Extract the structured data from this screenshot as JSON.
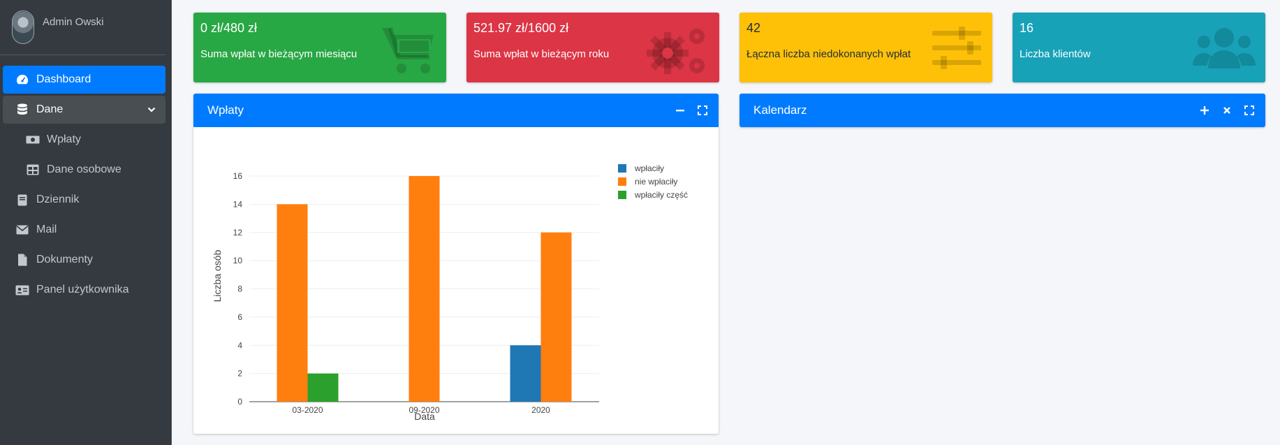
{
  "user": {
    "name": "Admin Owski"
  },
  "sidebar": {
    "items": [
      {
        "label": "Dashboard",
        "icon": "tachometer-icon"
      },
      {
        "label": "Dane",
        "icon": "database-icon"
      },
      {
        "label": "Wpłaty",
        "icon": "money-bill-icon"
      },
      {
        "label": "Dane osobowe",
        "icon": "table-icon"
      },
      {
        "label": "Dziennik",
        "icon": "book-icon"
      },
      {
        "label": "Mail",
        "icon": "envelope-icon"
      },
      {
        "label": "Dokumenty",
        "icon": "file-icon"
      },
      {
        "label": "Panel użytkownika",
        "icon": "id-card-icon"
      }
    ]
  },
  "info_boxes": [
    {
      "value": "0 zł/480 zł",
      "label": "Suma wpłat w bieżącym miesiącu",
      "color": "#28a745",
      "icon": "shopping-cart-icon"
    },
    {
      "value": "521.97 zł/1600 zł",
      "label": "Suma wpłat w bieżącym roku",
      "color": "#dc3545",
      "icon": "cogs-icon"
    },
    {
      "value": "42",
      "label": "Łączna liczba niedokonanych wpłat",
      "color": "#ffc107",
      "icon": "sliders-icon"
    },
    {
      "value": "16",
      "label": "Liczba klientów",
      "color": "#17a2b8",
      "icon": "users-icon"
    }
  ],
  "cards": {
    "payments": {
      "title": "Wpłaty"
    },
    "calendar": {
      "title": "Kalendarz"
    }
  },
  "chart_data": {
    "type": "bar",
    "categories": [
      "03-2020",
      "09-2020",
      "2020"
    ],
    "series": [
      {
        "name": "wpłaciły",
        "color": "#1f77b4",
        "values": [
          0,
          0,
          4
        ]
      },
      {
        "name": "nie wpłaciły",
        "color": "#ff7f0e",
        "values": [
          14,
          16,
          12
        ]
      },
      {
        "name": "wpłaciły część",
        "color": "#2ca02c",
        "values": [
          2,
          0,
          0
        ]
      }
    ],
    "xlabel": "Data",
    "ylabel": "Liczba osób",
    "ylim": [
      0,
      16
    ],
    "yticks": [
      0,
      2,
      4,
      6,
      8,
      10,
      12,
      14,
      16
    ],
    "grid": true,
    "legend": "top-right"
  }
}
